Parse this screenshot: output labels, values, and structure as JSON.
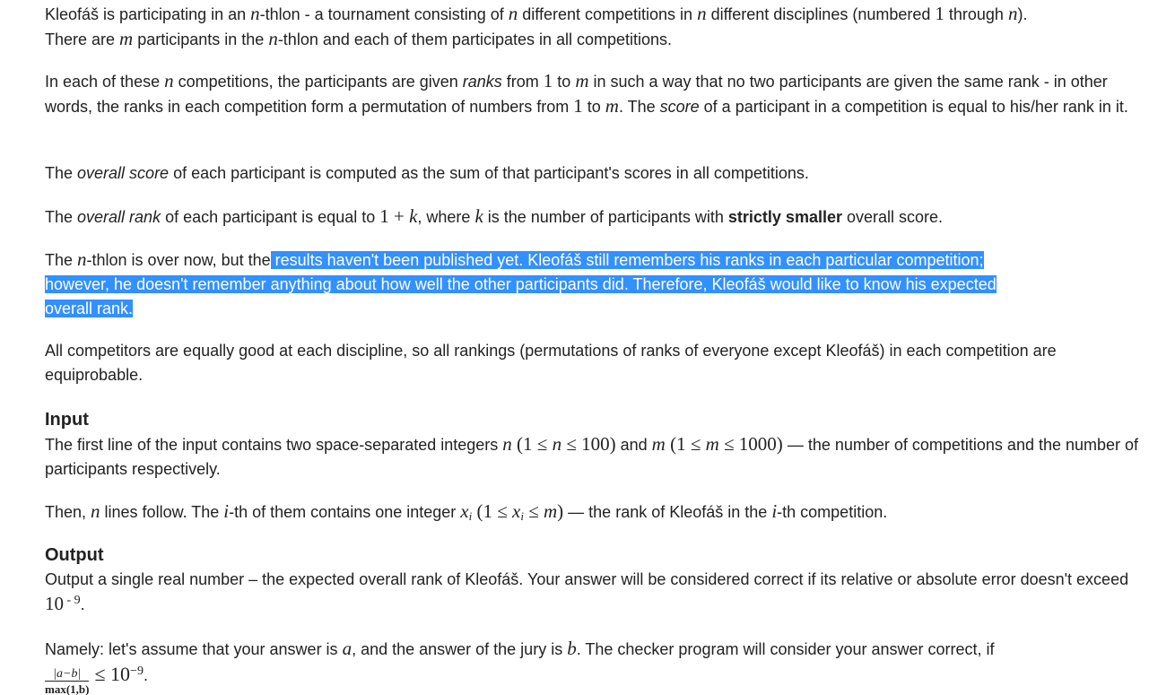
{
  "p1": {
    "t1": "Kleofáš is participating in an ",
    "m1": "n",
    "t2": "-thlon - a tournament consisting of ",
    "m2": "n",
    "t3": " different competitions in ",
    "m3": "n",
    "t4": " different disciplines (numbered ",
    "m4": "1",
    "t5": " through ",
    "m5": "n",
    "t6": ").",
    "t7": "There are ",
    "m6": "m",
    "t8": " participants in the ",
    "m7": "n",
    "t9": "-thlon and each of them participates in all competitions."
  },
  "p2": {
    "t1": "In each of these ",
    "m1": "n",
    "t2": " competitions, the participants are given ",
    "e1": "ranks",
    "t3": " from ",
    "m2": "1",
    "t4": " to ",
    "m3": "m",
    "t5": " in such a way that no two participants are given the same rank - in other words, the ranks in each competition form a permutation of numbers from ",
    "m4": "1",
    "t6": " to ",
    "m5": "m",
    "t7": ". The ",
    "e2": "score",
    "t8": " of a participant in a competition is equal to his/her rank in it."
  },
  "p3": {
    "t1": "The ",
    "e1": "overall score",
    "t2": " of each participant is computed as the sum of that participant's scores in all competitions."
  },
  "p4": {
    "t1": "The ",
    "e1": "overall rank",
    "t2": " of each participant is equal to ",
    "m1": "1 + ",
    "m2": "k",
    "t3": ", where ",
    "m3": "k",
    "t4": " is the number of participants with ",
    "b1": "strictly smaller",
    "t5": " overall score."
  },
  "p5": {
    "t1": "The ",
    "m1": "n",
    "t2": "-thlon is over now, but the",
    "s1": " results haven't been published yet. Kleofáš still remembers his ranks in each particular competition;",
    "s2": "however, he doesn't remember anything about how well the other participants did. Therefore, Kleofáš would like to know his expected",
    "s3": "overall rank."
  },
  "p6": {
    "t1": "All competitors are equally good at each discipline, so all rankings (permutations of ranks of everyone except Kleofáš) in each competition are equiprobable."
  },
  "input_heading": "Input",
  "p7": {
    "t1": "The first line of the input contains two space-separated integers ",
    "m1": "n",
    "m2": " (1 ≤ ",
    "m3": "n",
    "m4": " ≤ 100)",
    "t2": " and ",
    "m5": "m",
    "m6": " (1 ≤ ",
    "m7": "m",
    "m8": " ≤ 1000)",
    "t3": " — the number of competitions and the number of participants respectively."
  },
  "p8": {
    "t1": "Then, ",
    "m1": "n",
    "t2": " lines follow. The ",
    "m2": "i",
    "t3": "-th of them contains one integer ",
    "m3": "x",
    "m3s": "i",
    "m4": " (1 ≤ ",
    "m5": "x",
    "m5s": "i",
    "m6": " ≤ ",
    "m7": "m",
    "m8": ")",
    "t4": " — the rank of Kleofáš in the ",
    "m9": "i",
    "t5": "-th competition."
  },
  "output_heading": "Output",
  "p9": {
    "t1": "Output a single real number – the expected overall rank of Kleofáš. Your answer will be considered correct if its relative or absolute error doesn't exceed ",
    "m1": "10",
    "m1e": " - 9",
    "t2": "."
  },
  "p10": {
    "t1": "Namely: let's assume that your answer is ",
    "m1": "a",
    "t2": ", and the answer of the jury is ",
    "m2": "b",
    "t3": ". The checker program will consider your answer correct, if ",
    "fnum": "|a−b|",
    "fden": "max(1,b)",
    "m3": "≤ 10",
    "m3e": "−9",
    "t4": "."
  }
}
